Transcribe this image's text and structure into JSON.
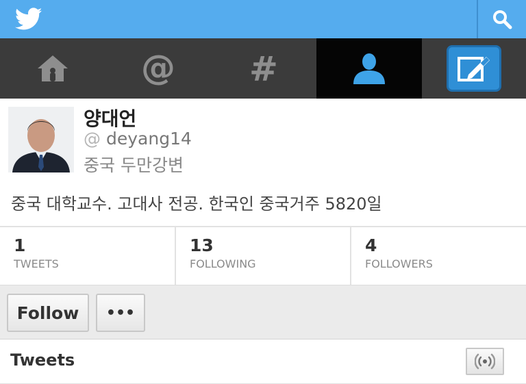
{
  "topbar": {
    "logo_icon": "twitter-bird-icon",
    "search_icon": "search-icon",
    "bg_color": "#55acee"
  },
  "nav": {
    "tabs": [
      {
        "name": "home",
        "icon": "home-icon",
        "active": false
      },
      {
        "name": "connect",
        "icon": "at-icon",
        "active": false
      },
      {
        "name": "discover",
        "icon": "hashtag-icon",
        "active": false
      },
      {
        "name": "me",
        "icon": "user-icon",
        "active": true
      },
      {
        "name": "compose",
        "icon": "compose-icon",
        "active": false
      }
    ]
  },
  "profile": {
    "name": "양대언",
    "at": "@",
    "handle": "deyang14",
    "location": "중국 두만강변",
    "bio": "중국 대학교수. 고대사 전공. 한국인 중국거주 5820일"
  },
  "stats": [
    {
      "value": "1",
      "label": "TWEETS"
    },
    {
      "value": "13",
      "label": "FOLLOWING"
    },
    {
      "value": "4",
      "label": "FOLLOWERS"
    }
  ],
  "actions": {
    "follow_label": "Follow",
    "more_label": "•••"
  },
  "tweets": {
    "title": "Tweets",
    "refresh_icon": "refresh-icon"
  }
}
